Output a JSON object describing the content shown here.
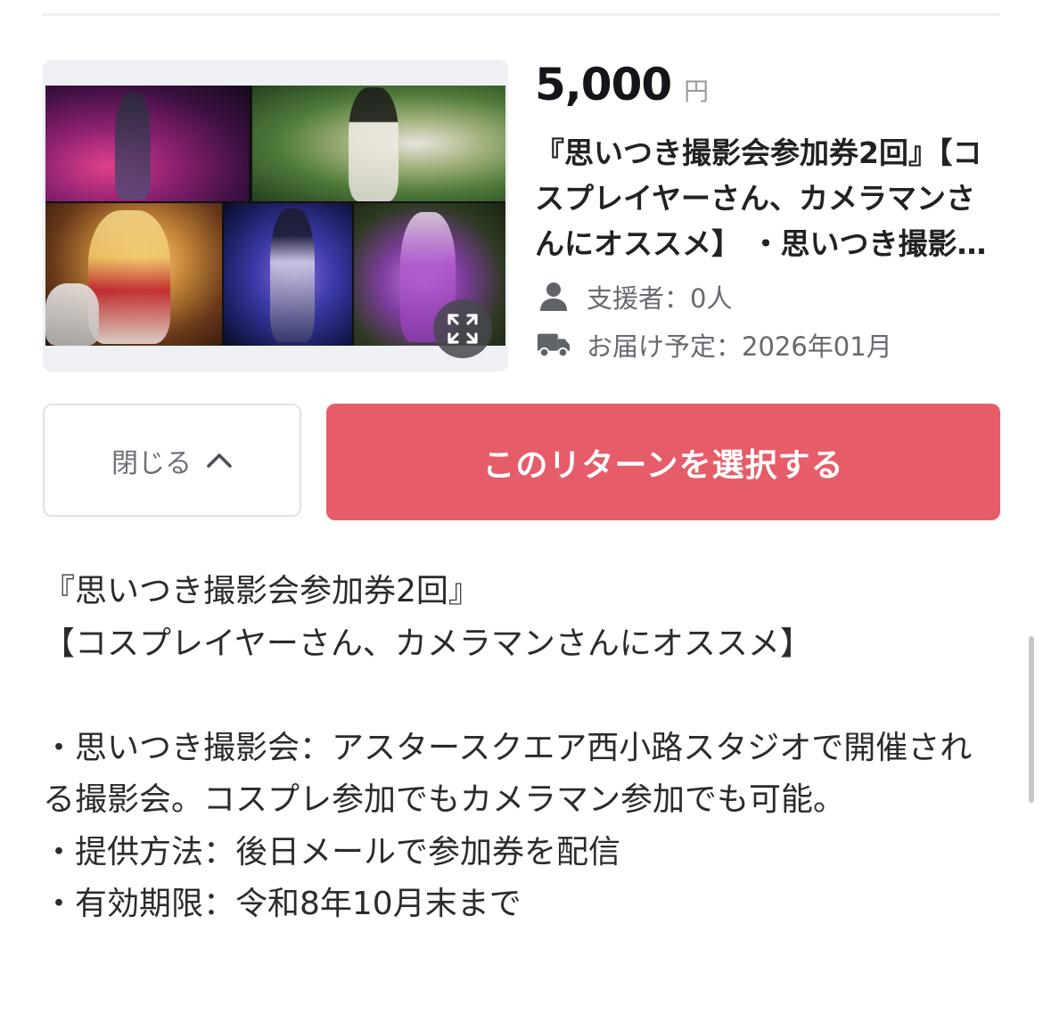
{
  "reward": {
    "price": "5,000",
    "currency": "円",
    "title": "『思いつき撮影会参加券2回』【コスプレイヤーさん、カメラマンさんにオススメ】 ・思いつき撮影会：アスタースクエア西小路スタジオで開催される撮影会。",
    "backers": "支援者：0人",
    "delivery": "お届け予定：2026年01月",
    "icons": {
      "backers": "person-icon",
      "delivery": "truck-icon",
      "expand": "expand-icon",
      "close": "chevron-up-icon"
    }
  },
  "actions": {
    "close_label": "閉じる",
    "select_label": "このリターンを選択する"
  },
  "description": {
    "lines": [
      "『思いつき撮影会参加券2回』",
      "【コスプレイヤーさん、カメラマンさんにオススメ】",
      "",
      "・思いつき撮影会：アスタースクエア西小路スタジオで開催される撮影会。コスプレ参加でもカメラマン参加でも可能。",
      "・提供方法：後日メールで参加券を配信",
      "・有効期限：令和8年10月末まで"
    ]
  },
  "colors": {
    "accent": "#e65c69",
    "price_text": "#14141a",
    "muted_text": "#666a70"
  }
}
